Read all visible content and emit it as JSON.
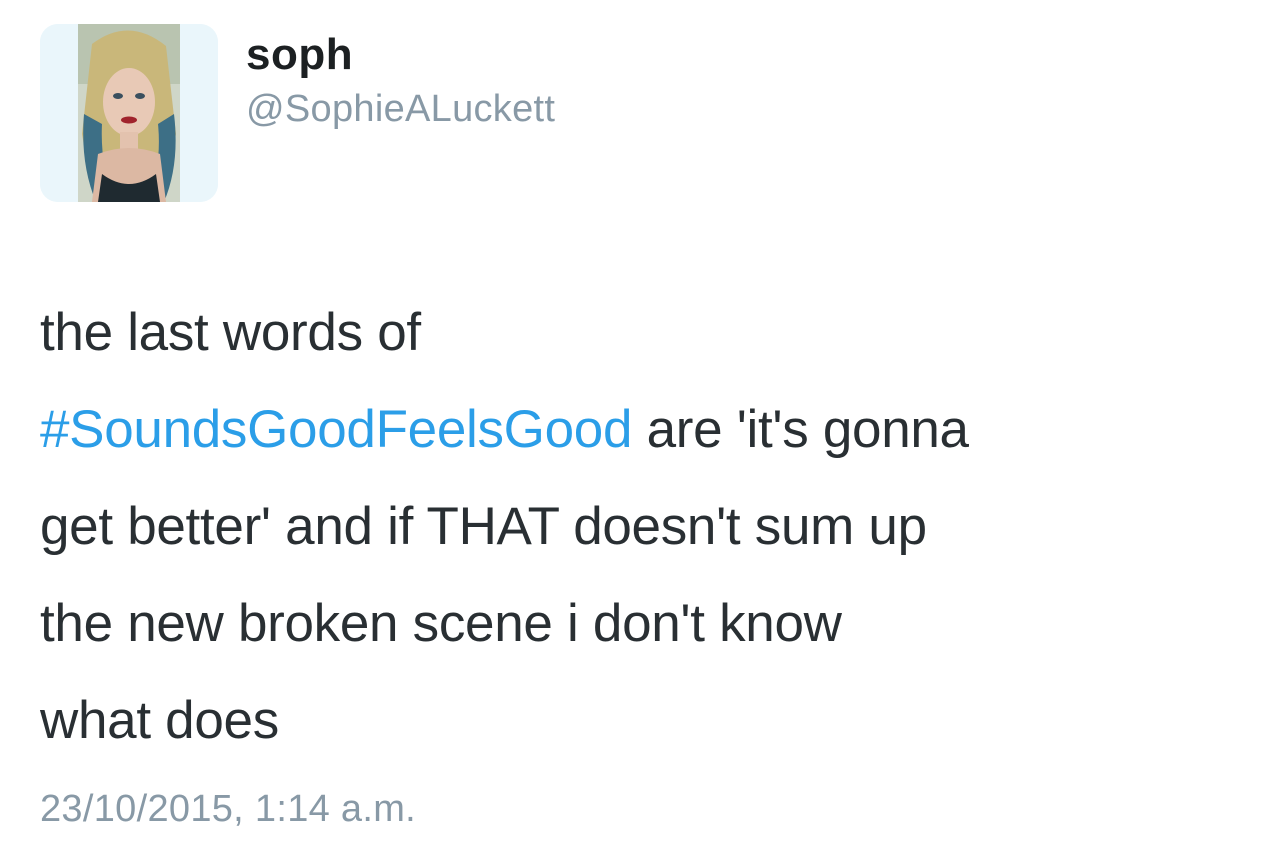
{
  "user": {
    "display_name": "soph",
    "handle": "@SophieALuckett"
  },
  "tweet": {
    "line1": "the last words of",
    "hashtag": "#SoundsGoodFeelsGood",
    "line2_rest": " are 'it's gonna",
    "line3": "get better' and if THAT doesn't sum up",
    "line4": "the new broken scene i don't know",
    "line5": "what does",
    "timestamp": "23/10/2015, 1:14 a.m."
  },
  "colors": {
    "hashtag": "#2b9ee8",
    "secondary_text": "#8899a6",
    "body_text": "#292f33"
  }
}
